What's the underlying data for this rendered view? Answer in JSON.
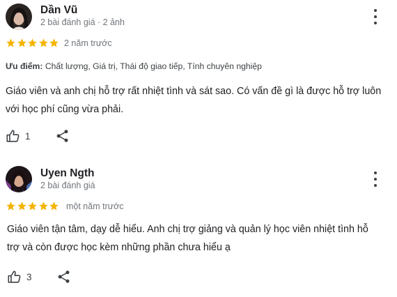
{
  "reviews": [
    {
      "author": "Dần Vũ",
      "meta": "2 bài đánh giá · 2 ảnh",
      "rating": 5,
      "time": "2 năm trước",
      "pros_label": "Ưu điểm:",
      "pros_text": "Chất lượng, Giá trị, Thái độ giao tiếp, Tính chuyên nghiệp",
      "text": "Giáo viên và anh chị hỗ trợ rất nhiệt tình và sát sao. Có vấn đề gì là được hỗ trợ luôn với học phí cũng vừa phải.",
      "likes": "1"
    },
    {
      "author": "Uyen Ngth",
      "meta": "2 bài đánh giá",
      "rating": 5,
      "time": "một năm trước",
      "text": "Giáo viên tận tâm, dạy dễ hiểu. Anh chị trợ giảng và quản lý học viên nhiệt tình hỗ trợ và còn được học kèm những phần chưa hiểu ạ",
      "likes": "3"
    }
  ],
  "colors": {
    "star": "#f4b400",
    "text": "#202124",
    "secondary": "#70757a"
  },
  "icons": [
    "thumbs-up-icon",
    "share-icon",
    "more-vert-icon",
    "star-icon"
  ]
}
